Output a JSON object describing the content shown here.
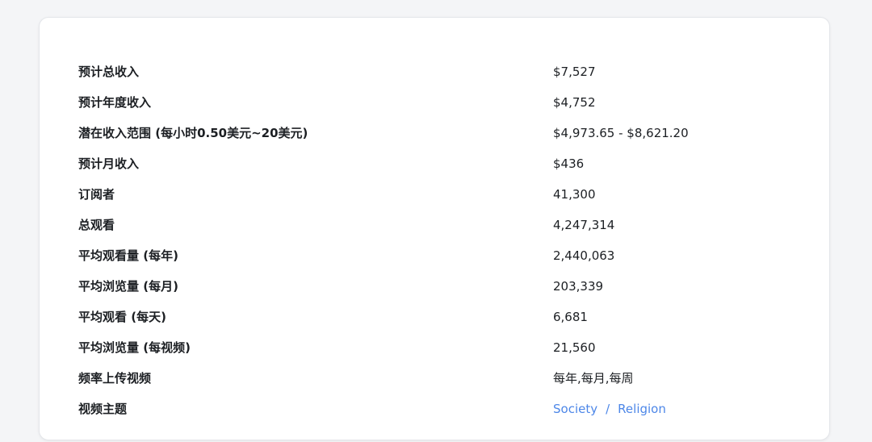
{
  "stats": [
    {
      "label": "预计总收入",
      "value": "$7,527"
    },
    {
      "label": "预计年度收入",
      "value": "$4,752"
    },
    {
      "label": "潜在收入范围 (每小时0.50美元~20美元)",
      "value": "$4,973.65 - $8,621.20"
    },
    {
      "label": "预计月收入",
      "value": "$436"
    },
    {
      "label": "订阅者",
      "value": "41,300"
    },
    {
      "label": "总观看",
      "value": "4,247,314"
    },
    {
      "label": "平均观看量 (每年)",
      "value": "2,440,063"
    },
    {
      "label": "平均浏览量 (每月)",
      "value": "203,339"
    },
    {
      "label": "平均观看 (每天)",
      "value": "6,681"
    },
    {
      "label": "平均浏览量 (每视频)",
      "value": "21,560"
    },
    {
      "label": "频率上传视频",
      "value": "每年,每月,每周"
    }
  ],
  "topics": {
    "label": "视频主题",
    "links": [
      "Society",
      "Religion"
    ],
    "separator": "/"
  },
  "colors": {
    "link": "#4d87e8",
    "text": "#1c1f23"
  }
}
